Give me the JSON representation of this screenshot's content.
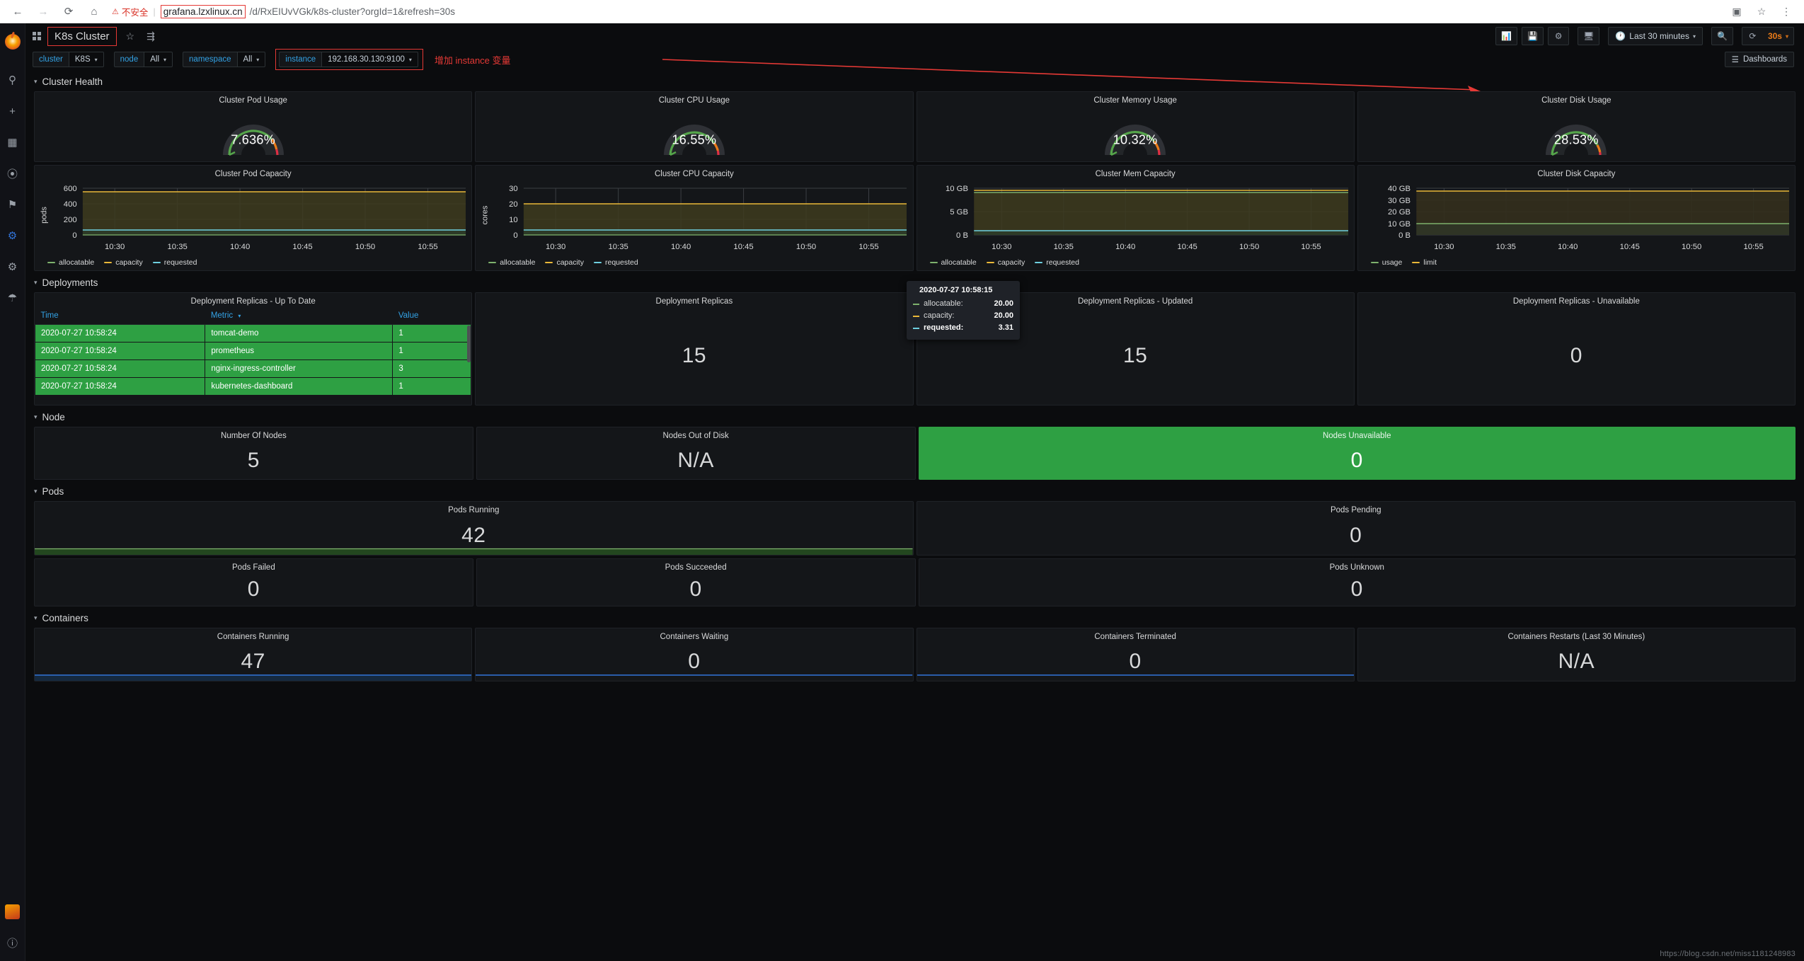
{
  "browser": {
    "back_icon": "back-arrow-icon",
    "forward_icon": "forward-arrow-icon",
    "reload_icon": "reload-icon",
    "home_icon": "home-icon",
    "insecure_label": "不安全",
    "url_host": "grafana.lzxlinux.cn",
    "url_path": "/d/RxEIUvVGk/k8s-cluster?orgId=1&refresh=30s",
    "star_icon": "bookmark-star-icon",
    "extensions_icon": "extensions-icon",
    "menu_icon": "overflow-menu-icon"
  },
  "sidebar": {
    "logo": "grafana-logo",
    "items": [
      {
        "name": "search",
        "glyph": "⌕"
      },
      {
        "name": "create",
        "glyph": "+"
      },
      {
        "name": "dashboards",
        "glyph": "▦"
      },
      {
        "name": "explore",
        "glyph": "⦿"
      },
      {
        "name": "alerting",
        "glyph": "⚑"
      },
      {
        "name": "configuration-active",
        "glyph": "⚙"
      },
      {
        "name": "server-admin",
        "glyph": "⚙"
      },
      {
        "name": "shield",
        "glyph": "⛊"
      }
    ],
    "bottom": [
      {
        "name": "user-avatar",
        "glyph": ""
      },
      {
        "name": "help",
        "glyph": "?"
      }
    ]
  },
  "header": {
    "title": "K8s Cluster",
    "star_icon": "star-icon",
    "share_icon": "share-icon",
    "tools": {
      "add_panel": "add-panel-icon",
      "save": "save-icon",
      "settings": "gear-icon",
      "tv_mode": "tv-mode-icon",
      "time_range": "Last 30 minutes",
      "zoom_out": "zoom-out-icon",
      "refresh": "refresh-icon",
      "refresh_interval": "30s"
    }
  },
  "variables": [
    {
      "label": "cluster",
      "value": "K8S",
      "highlighted": false
    },
    {
      "label": "node",
      "value": "All",
      "highlighted": false
    },
    {
      "label": "namespace",
      "value": "All",
      "highlighted": false
    },
    {
      "label": "instance",
      "value": "192.168.30.130:9100",
      "highlighted": true
    }
  ],
  "annotation": {
    "text": "增加 instance 变量",
    "color": "#e53935"
  },
  "submenu_right": {
    "dashboards_button": "Dashboards",
    "dashboards_icon": "list-icon"
  },
  "rows": {
    "cluster_health": "Cluster Health",
    "deployments": "Deployments",
    "node": "Node",
    "pods": "Pods",
    "containers": "Containers"
  },
  "gauges": [
    {
      "title": "Cluster Pod Usage",
      "value": "7.636%",
      "pct": 7.636
    },
    {
      "title": "Cluster CPU Usage",
      "value": "16.55%",
      "pct": 16.55
    },
    {
      "title": "Cluster Memory Usage",
      "value": "10.32%",
      "pct": 10.32
    },
    {
      "title": "Cluster Disk Usage",
      "value": "28.53%",
      "pct": 28.53
    }
  ],
  "capacity_charts": [
    {
      "title": "Cluster Pod Capacity",
      "ylabel": "pods",
      "yticks": [
        "600",
        "400",
        "200",
        "0"
      ],
      "xticks": [
        "10:30",
        "10:35",
        "10:40",
        "10:45",
        "10:50",
        "10:55"
      ],
      "legend": [
        {
          "name": "allocatable",
          "color": "#7eb26d"
        },
        {
          "name": "capacity",
          "color": "#eab839"
        },
        {
          "name": "requested",
          "color": "#6ed0e0"
        }
      ]
    },
    {
      "title": "Cluster CPU Capacity",
      "ylabel": "cores",
      "yticks": [
        "30",
        "20",
        "10",
        "0"
      ],
      "xticks": [
        "10:30",
        "10:35",
        "10:40",
        "10:45",
        "10:50",
        "10:55"
      ],
      "legend": [
        {
          "name": "allocatable",
          "color": "#7eb26d"
        },
        {
          "name": "capacity",
          "color": "#eab839"
        },
        {
          "name": "requested",
          "color": "#6ed0e0"
        }
      ]
    },
    {
      "title": "Cluster Mem Capacity",
      "ylabel": "",
      "yticks": [
        "10 GB",
        "5 GB",
        "0 B"
      ],
      "xticks": [
        "10:30",
        "10:35",
        "10:40",
        "10:45",
        "10:50",
        "10:55"
      ],
      "legend": [
        {
          "name": "allocatable",
          "color": "#7eb26d"
        },
        {
          "name": "capacity",
          "color": "#eab839"
        },
        {
          "name": "requested",
          "color": "#6ed0e0"
        }
      ]
    },
    {
      "title": "Cluster Disk Capacity",
      "ylabel": "",
      "yticks": [
        "40 GB",
        "30 GB",
        "20 GB",
        "10 GB",
        "0 B"
      ],
      "xticks": [
        "10:30",
        "10:35",
        "10:40",
        "10:45",
        "10:50",
        "10:55"
      ],
      "legend": [
        {
          "name": "usage",
          "color": "#7eb26d"
        },
        {
          "name": "limit",
          "color": "#eab839"
        }
      ]
    }
  ],
  "tooltip": {
    "time": "2020-07-27 10:58:15",
    "rows": [
      {
        "name": "allocatable:",
        "value": "20.00",
        "color": "#7eb26d",
        "bold": false
      },
      {
        "name": "capacity:",
        "value": "20.00",
        "color": "#eab839",
        "bold": false
      },
      {
        "name": "requested:",
        "value": "3.31",
        "color": "#6ed0e0",
        "bold": true
      }
    ]
  },
  "deployment_table": {
    "title": "Deployment Replicas - Up To Date",
    "columns": [
      "Time",
      "Metric",
      "Value"
    ],
    "sort_icon": "chevron-down-icon",
    "rows": [
      {
        "time": "2020-07-27 10:58:24",
        "metric": "tomcat-demo",
        "value": "1"
      },
      {
        "time": "2020-07-27 10:58:24",
        "metric": "prometheus",
        "value": "1"
      },
      {
        "time": "2020-07-27 10:58:24",
        "metric": "nginx-ingress-controller",
        "value": "3"
      },
      {
        "time": "2020-07-27 10:58:24",
        "metric": "kubernetes-dashboard",
        "value": "1"
      }
    ]
  },
  "stats": {
    "deployments": [
      {
        "title": "Deployment Replicas",
        "value": "15",
        "green": false,
        "spark": false
      },
      {
        "title": "Deployment Replicas - Updated",
        "value": "15",
        "green": false,
        "spark": false
      },
      {
        "title": "Deployment Replicas - Unavailable",
        "value": "0",
        "green": false,
        "spark": false
      }
    ],
    "node": [
      {
        "title": "Number Of Nodes",
        "value": "5",
        "green": false,
        "spark": false
      },
      {
        "title": "Nodes Out of Disk",
        "value": "N/A",
        "green": false,
        "spark": false
      },
      {
        "title": "Nodes Unavailable",
        "value": "0",
        "green": true,
        "spark": false
      }
    ],
    "pods_top": [
      {
        "title": "Pods Running",
        "value": "42",
        "green": false,
        "spark": true,
        "spark_color": "#7eb26d",
        "spark_fill": "#23471f"
      },
      {
        "title": "Pods Pending",
        "value": "0",
        "green": false,
        "spark": false
      }
    ],
    "pods_bottom": [
      {
        "title": "Pods Failed",
        "value": "0",
        "green": false,
        "spark": false
      },
      {
        "title": "Pods Succeeded",
        "value": "0",
        "green": false,
        "spark": false
      },
      {
        "title": "Pods Unknown",
        "value": "0",
        "green": false,
        "spark": false
      }
    ],
    "containers": [
      {
        "title": "Containers Running",
        "value": "47",
        "green": false,
        "spark": true,
        "spark_color": "#3274d9",
        "spark_fill": "#15293f"
      },
      {
        "title": "Containers Waiting",
        "value": "0",
        "green": false,
        "spark": true,
        "spark_color": "#3274d9",
        "spark_fill": "transparent"
      },
      {
        "title": "Containers Terminated",
        "value": "0",
        "green": false,
        "spark": true,
        "spark_color": "#3274d9",
        "spark_fill": "transparent"
      },
      {
        "title": "Containers Restarts (Last 30 Minutes)",
        "value": "N/A",
        "green": false,
        "spark": false
      }
    ]
  },
  "watermark": "https://blog.csdn.net/miss1181248983"
}
